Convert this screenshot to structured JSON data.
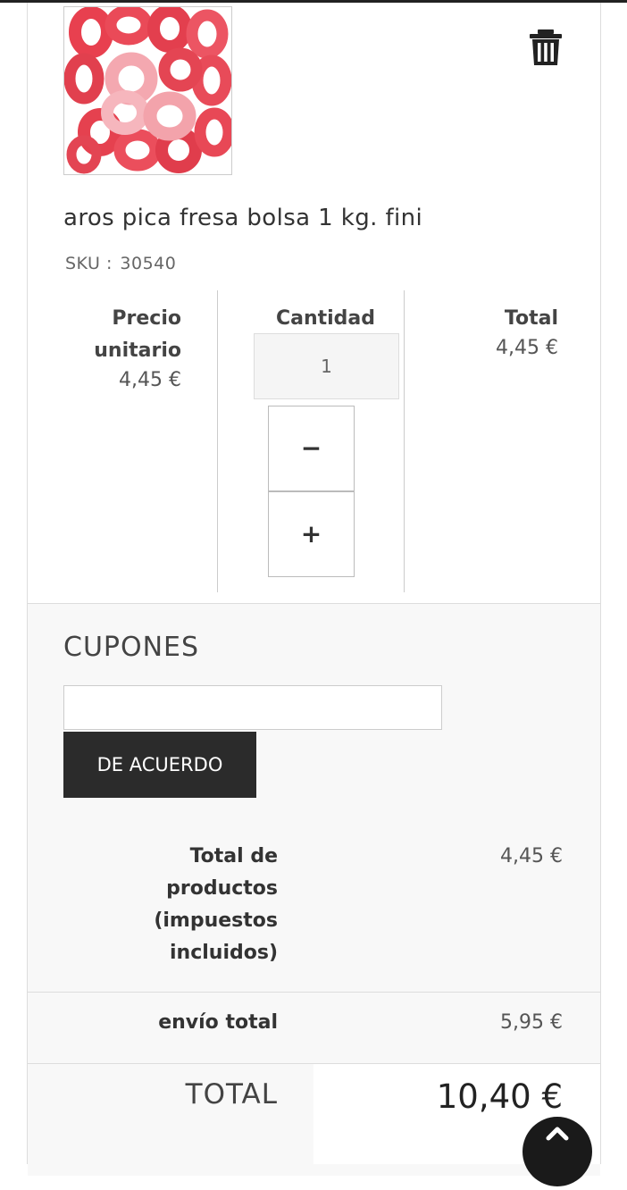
{
  "product": {
    "name": "aros pica fresa bolsa 1 kg. fini",
    "sku_label": "SKU :",
    "sku": "30540",
    "image_icon": "strawberry-rings-candy-image",
    "delete_icon": "trash-icon"
  },
  "columns": {
    "unit_price_header_1": "Precio",
    "unit_price_header_2": "unitario",
    "unit_price": "4,45 €",
    "quantity_header": "Cantidad",
    "quantity": "1",
    "minus": "−",
    "plus": "+",
    "total_header": "Total",
    "total": "4,45 €"
  },
  "coupons": {
    "title": "CUPONES",
    "input_value": "",
    "button_label": "DE ACUERDO"
  },
  "summary": {
    "products_label_1": "Total de",
    "products_label_2": "productos",
    "products_label_3": "(impuestos",
    "products_label_4": "incluidos)",
    "products_value": "4,45 €",
    "shipping_label": "envío total",
    "shipping_value": "5,95 €",
    "total_label": "TOTAL",
    "total_value": "10,40 €"
  },
  "colors": {
    "button_bg": "#2b2b2b",
    "panel_bg": "#f8f8f8"
  }
}
